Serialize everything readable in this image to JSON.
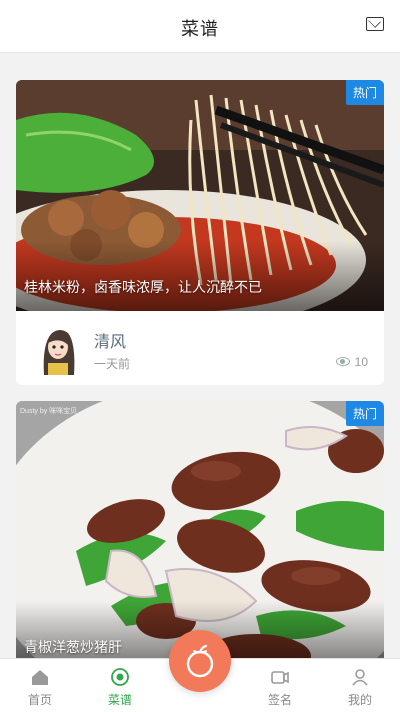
{
  "header": {
    "title": "菜谱",
    "mail_icon": "mail-icon"
  },
  "feed": {
    "cards": [
      {
        "badge": "热门",
        "caption": "桂林米粉，卤香味浓厚，让人沉醉不已",
        "author": "清风",
        "time": "一天前",
        "views": "10"
      },
      {
        "badge": "热门",
        "caption": "青椒洋葱炒猪肝",
        "watermark": "Dusty by 咪咪宝贝"
      }
    ]
  },
  "tabbar": {
    "items": [
      {
        "label": "首页",
        "icon": "home-icon"
      },
      {
        "label": "菜谱",
        "icon": "target-icon"
      },
      {
        "label": "",
        "icon": "tomato-icon"
      },
      {
        "label": "签名",
        "icon": "camera-icon"
      },
      {
        "label": "我的",
        "icon": "user-icon"
      }
    ],
    "active_color": "#2ea84a",
    "fab_color": "#f27a5a"
  }
}
